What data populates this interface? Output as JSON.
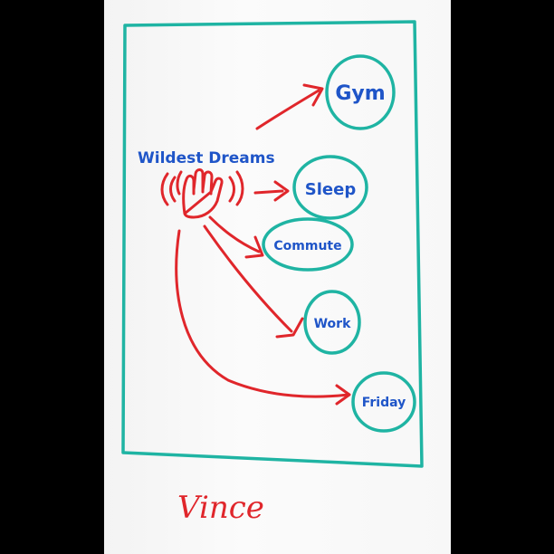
{
  "diagram": {
    "source": "Wildest Dreams",
    "targets": [
      "Gym",
      "Sleep",
      "Commute",
      "Work",
      "Friday"
    ],
    "signature": "Vince"
  },
  "colors": {
    "board_frame": "#1fb4a3",
    "arrows": "#e0262b",
    "label_text": "#1f55c8",
    "signature": "#e0262b"
  },
  "icons": {
    "source_icon": "waving-hand-icon"
  }
}
